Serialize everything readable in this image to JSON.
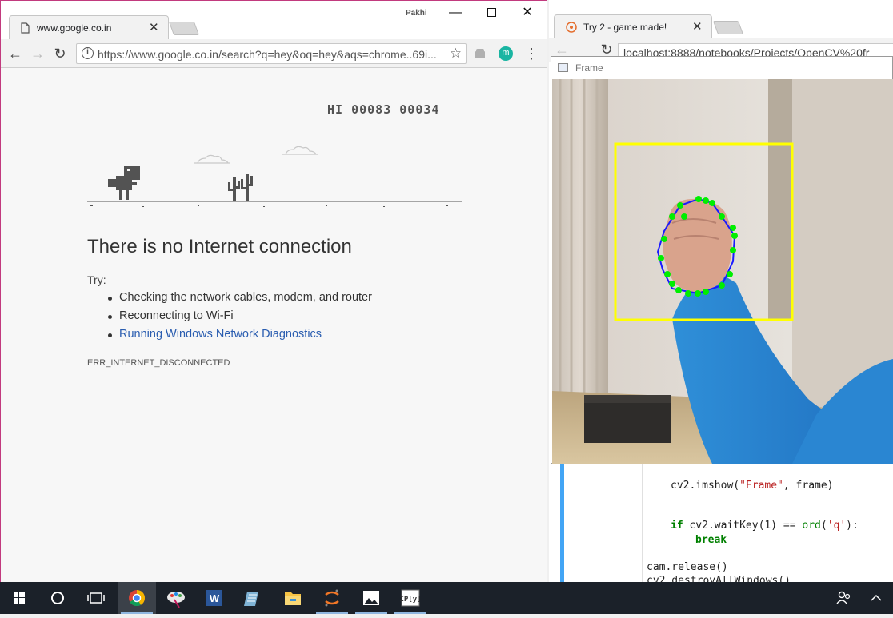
{
  "left_window": {
    "tab_title": "www.google.co.in",
    "user_name": "Pakhi",
    "url": "https://www.google.co.in/search?q=hey&oq=hey&aqs=chrome..69i...",
    "extension_badge": "m",
    "dino": {
      "score_text": "HI 00083 00034"
    },
    "error": {
      "heading": "There is no Internet connection",
      "try_label": "Try:",
      "suggestions": [
        "Checking the network cables, modem, and router",
        "Reconnecting to Wi-Fi",
        "Running Windows Network Diagnostics"
      ],
      "code": "ERR_INTERNET_DISCONNECTED"
    }
  },
  "right_window": {
    "tab_title": "Try 2 - game made!",
    "url": "localhost:8888/notebooks/Projects/OpenCV%20fr",
    "frame_window_title": "Frame",
    "code_lines": {
      "imshow_pre": "cv2.imshow(",
      "imshow_str": "\"Frame\"",
      "imshow_post": ", frame)",
      "if_kw": "if",
      "if_mid": " cv2.waitKey(1) == ",
      "ord_fn": "ord",
      "ord_open": "(",
      "ord_str": "'q'",
      "ord_close": "):",
      "break_kw": "break",
      "release": "cam.release()",
      "destroy": "cv2.destroyAllWindows()"
    }
  },
  "colors": {
    "window_border": "#c23a7e",
    "link": "#2a5db0",
    "notebook_cell_bar": "#42a5f5",
    "taskbar": "#1b2129",
    "bounding_box": "#ffff00",
    "hull_points": "#00ee00",
    "hull_line": "#1a1aff"
  },
  "taskbar": {
    "items": [
      "windows-start-icon",
      "cortana-search-icon",
      "task-view-icon",
      "chrome-icon",
      "paint-icon",
      "word-icon",
      "notepad-icon",
      "file-explorer-icon",
      "jupyter-icon",
      "photos-icon",
      "ipython-icon"
    ],
    "tray": [
      "people-icon",
      "chevron-up-icon"
    ]
  }
}
